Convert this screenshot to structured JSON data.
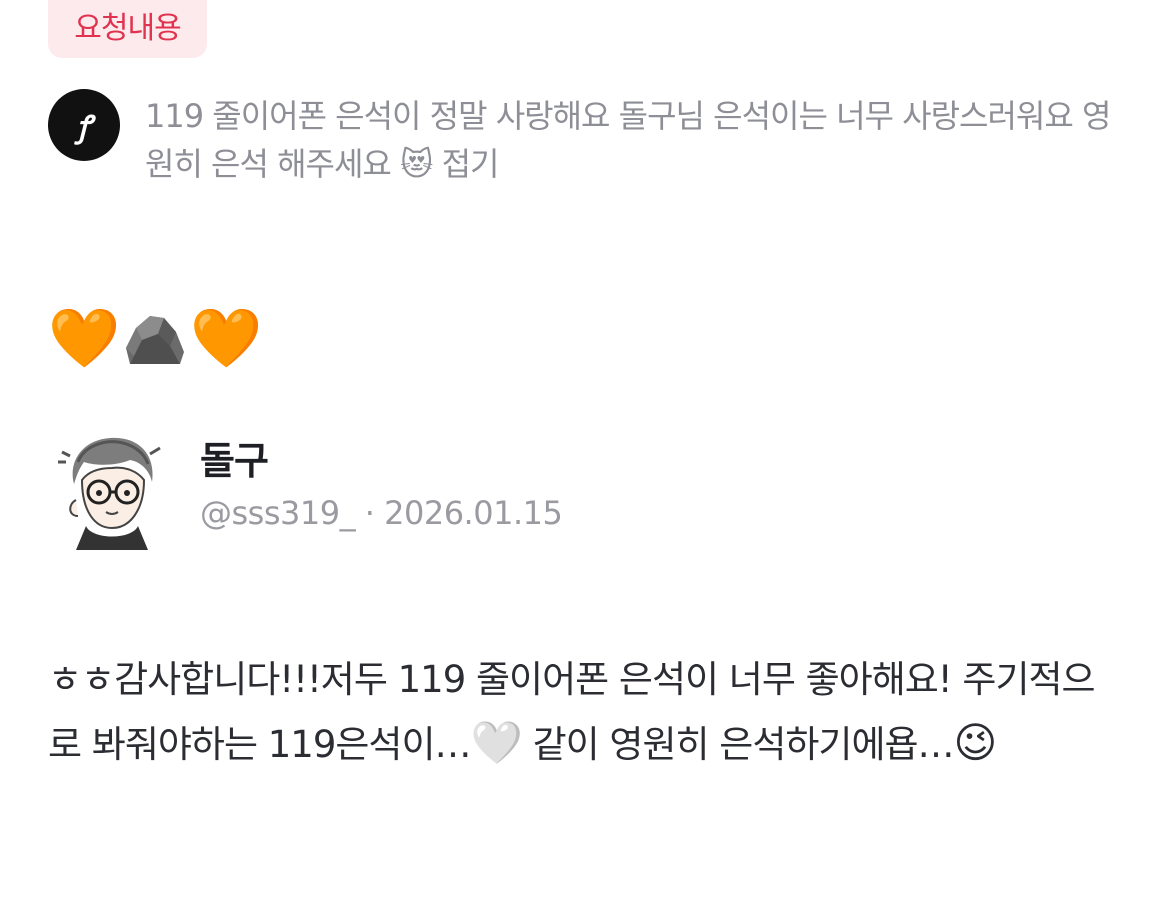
{
  "request": {
    "tag_label": "요청내용",
    "avatar_text": "ꝭ",
    "text": "119 줄이어폰 은석이 정말 사랑해요 돌구님 은석이는 너무 사랑스러워요 영원히 은석 해주세요 ",
    "emoji": "😻",
    "fold_label": "접기"
  },
  "reaction": {
    "emoji_left": "🧡",
    "emoji_middle": "rock-icon",
    "emoji_right": "🧡"
  },
  "profile": {
    "name": "돌구",
    "handle": "@sss319_",
    "separator": "·",
    "date": "2026.01.15"
  },
  "reply": {
    "text_part1": "ㅎㅎ감사합니다!!!저두 119 줄이어폰 은석이 너무 좋아해요! 주기적으로 봐줘야하는 119은석이…",
    "emoji1": "🤍",
    "text_part2": " 같이 영원히 은석하기에욥…",
    "emoji2": "😉"
  },
  "colors": {
    "tag_bg": "#fdeaec",
    "tag_text": "#e0334f",
    "muted_text": "#8e8f96",
    "body_text": "#2b2d33"
  }
}
